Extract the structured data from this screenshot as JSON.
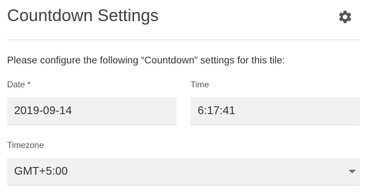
{
  "header": {
    "title": "Countdown Settings",
    "settings_icon": "gear-icon"
  },
  "intro_text": "Please configure the following “Countdown” settings for this tile:",
  "form": {
    "date": {
      "label": "Date",
      "required_mark": " *",
      "value": "2019-09-14"
    },
    "time": {
      "label": "Time",
      "value": "6:17:41"
    },
    "timezone": {
      "label": "Timezone",
      "value": "GMT+5:00",
      "icon": "chevron-down-icon"
    }
  },
  "colors": {
    "field_background": "#f1f1f1",
    "text": "#333333",
    "icon": "#555555"
  }
}
